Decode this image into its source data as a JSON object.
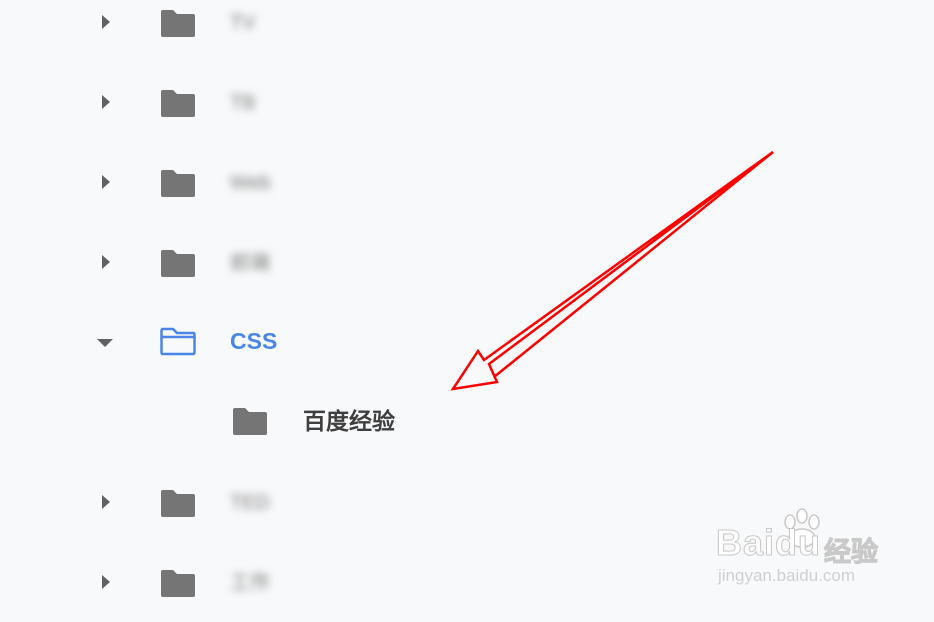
{
  "tree": {
    "items": [
      {
        "label": "TV",
        "expanded": false,
        "blurred": true,
        "active": false,
        "level": 0,
        "icon": "folder-icon"
      },
      {
        "label": "TB",
        "expanded": false,
        "blurred": true,
        "active": false,
        "level": 0,
        "icon": "folder-icon"
      },
      {
        "label": "Web",
        "expanded": false,
        "blurred": true,
        "active": false,
        "level": 0,
        "icon": "folder-icon"
      },
      {
        "label": "前端",
        "expanded": false,
        "blurred": true,
        "active": false,
        "level": 0,
        "icon": "folder-icon"
      },
      {
        "label": "CSS",
        "expanded": true,
        "blurred": false,
        "active": true,
        "level": 0,
        "icon": "folder-open-icon"
      },
      {
        "label": "百度经验",
        "expanded": false,
        "blurred": false,
        "active": false,
        "level": 1,
        "icon": "folder-icon"
      },
      {
        "label": "TED",
        "expanded": false,
        "blurred": true,
        "active": false,
        "level": 0,
        "icon": "folder-icon"
      },
      {
        "label": "工作",
        "expanded": false,
        "blurred": true,
        "active": false,
        "level": 0,
        "icon": "folder-icon"
      }
    ]
  },
  "annotation": {
    "type": "arrow",
    "color": "#ff0000",
    "points_to": "百度经验"
  },
  "watermark": {
    "brand": "Baidu",
    "brand_cn": "经验",
    "url": "jingyan.baidu.com"
  },
  "colors": {
    "background": "#f8f9fa",
    "folder": "#757575",
    "active": "#4a86e8",
    "caret": "#616161",
    "arrow": "#ff0000"
  }
}
